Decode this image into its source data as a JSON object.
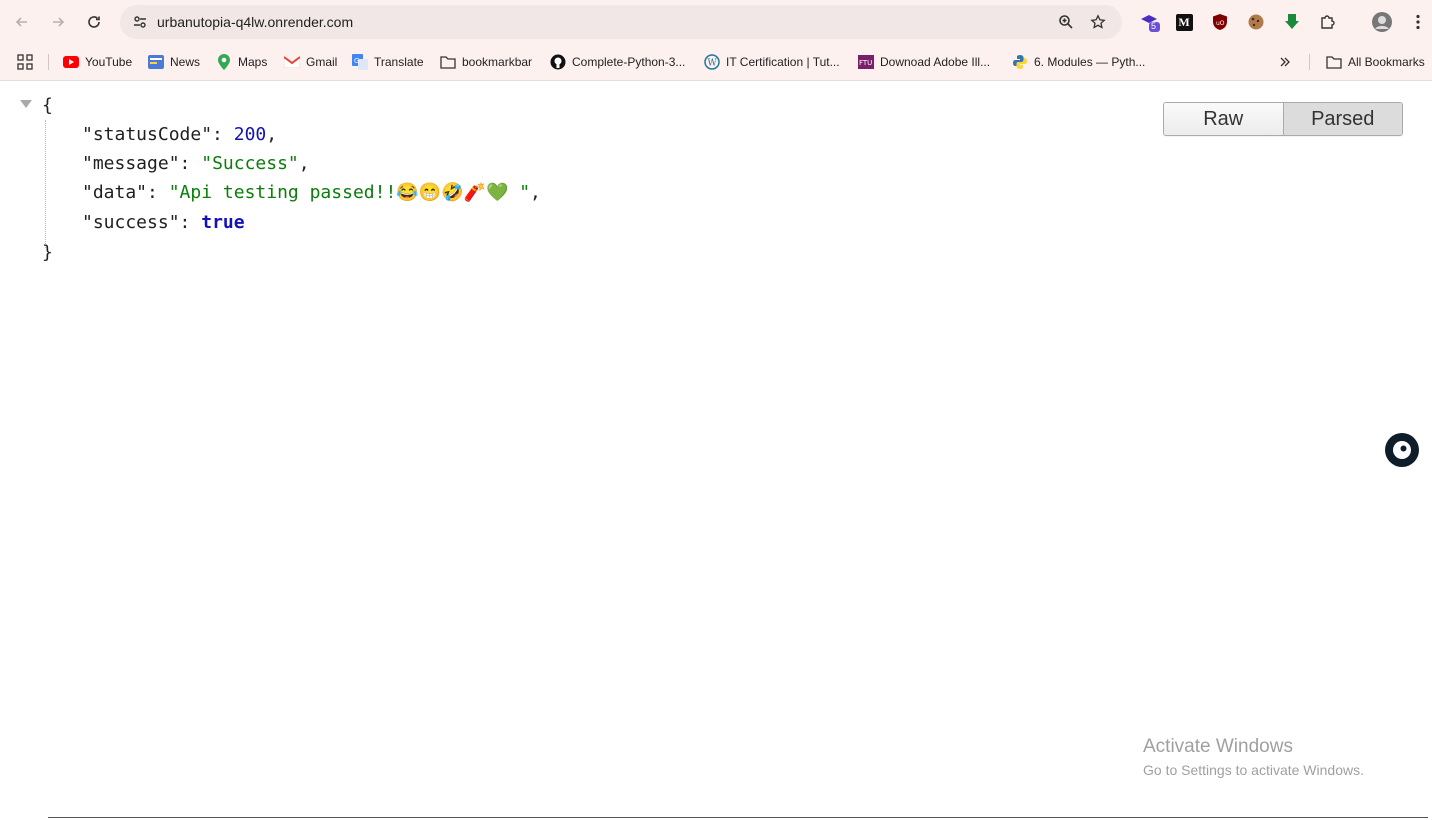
{
  "browser": {
    "url": "urbanutopia-q4lw.onrender.com",
    "extension_badge": "5"
  },
  "bookmarks": [
    {
      "label": "YouTube",
      "icon": "youtube-icon"
    },
    {
      "label": "News",
      "icon": "news-icon"
    },
    {
      "label": "Maps",
      "icon": "maps-icon"
    },
    {
      "label": "Gmail",
      "icon": "gmail-icon"
    },
    {
      "label": "Translate",
      "icon": "translate-icon"
    },
    {
      "label": "bookmarkbar",
      "icon": "folder-icon"
    },
    {
      "label": "Complete-Python-3...",
      "icon": "github-icon"
    },
    {
      "label": "IT Certification | Tut...",
      "icon": "wordpress-icon"
    },
    {
      "label": "Downoad Adobe Ill...",
      "icon": "ftu-icon"
    },
    {
      "label": "6. Modules — Pyth...",
      "icon": "python-icon"
    }
  ],
  "all_bookmarks": "All Bookmarks",
  "json_view": {
    "open_brace": "{",
    "close_brace": "}",
    "rows": [
      {
        "key": "\"statusCode\"",
        "value": "200",
        "type": "number",
        "suffix": ","
      },
      {
        "key": "\"message\"",
        "value": "\"Success\"",
        "type": "string",
        "suffix": ","
      },
      {
        "key": "\"data\"",
        "value": "\"Api testing passed!!😂😁🤣🧨💚 \"",
        "type": "string",
        "suffix": ","
      },
      {
        "key": "\"success\"",
        "value": "true",
        "type": "bool",
        "suffix": ""
      }
    ]
  },
  "view_toggle": {
    "raw": "Raw",
    "parsed": "Parsed",
    "active": "Parsed"
  },
  "watermark": {
    "title": "Activate Windows",
    "subtitle": "Go to Settings to activate Windows."
  },
  "colors": {
    "string": "#0a7d0a",
    "number": "#1212b8",
    "toolbar": "#fdf1f0"
  }
}
